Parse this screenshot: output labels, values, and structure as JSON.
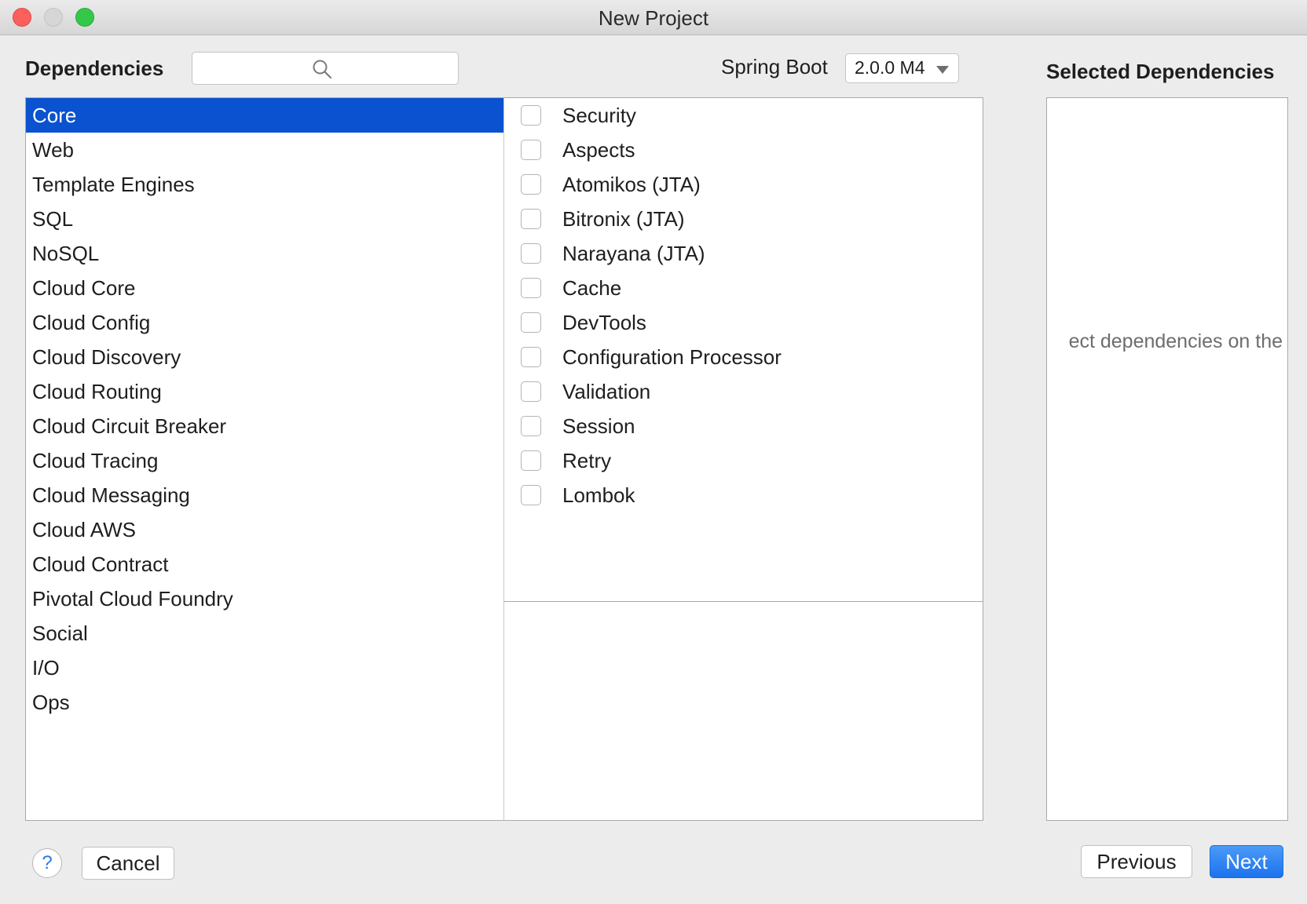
{
  "window": {
    "title": "New Project"
  },
  "header": {
    "dependencies_label": "Dependencies",
    "search_value": "",
    "spring_boot_label": "Spring Boot",
    "spring_boot_version": "2.0.0 M4",
    "selected_label": "Selected Dependencies"
  },
  "categories": [
    {
      "label": "Core",
      "selected": true
    },
    {
      "label": "Web"
    },
    {
      "label": "Template Engines"
    },
    {
      "label": "SQL"
    },
    {
      "label": "NoSQL"
    },
    {
      "label": "Cloud Core"
    },
    {
      "label": "Cloud Config"
    },
    {
      "label": "Cloud Discovery"
    },
    {
      "label": "Cloud Routing"
    },
    {
      "label": "Cloud Circuit Breaker"
    },
    {
      "label": "Cloud Tracing"
    },
    {
      "label": "Cloud Messaging"
    },
    {
      "label": "Cloud AWS"
    },
    {
      "label": "Cloud Contract"
    },
    {
      "label": "Pivotal Cloud Foundry"
    },
    {
      "label": "Social"
    },
    {
      "label": "I/O"
    },
    {
      "label": "Ops"
    }
  ],
  "dependencies": [
    {
      "label": "Security",
      "checked": false
    },
    {
      "label": "Aspects",
      "checked": false
    },
    {
      "label": "Atomikos (JTA)",
      "checked": false
    },
    {
      "label": "Bitronix (JTA)",
      "checked": false
    },
    {
      "label": "Narayana (JTA)",
      "checked": false
    },
    {
      "label": "Cache",
      "checked": false
    },
    {
      "label": "DevTools",
      "checked": false
    },
    {
      "label": "Configuration Processor",
      "checked": false
    },
    {
      "label": "Validation",
      "checked": false
    },
    {
      "label": "Session",
      "checked": false
    },
    {
      "label": "Retry",
      "checked": false
    },
    {
      "label": "Lombok",
      "checked": false
    }
  ],
  "selected_panel": {
    "empty_text": "ect dependencies on the"
  },
  "footer": {
    "help_label": "?",
    "cancel_label": "Cancel",
    "previous_label": "Previous",
    "next_label": "Next"
  },
  "colors": {
    "selection": "#0a52cf",
    "primary_button": "#1b73ed",
    "close": "#fc605c",
    "maximize": "#34c84a"
  }
}
